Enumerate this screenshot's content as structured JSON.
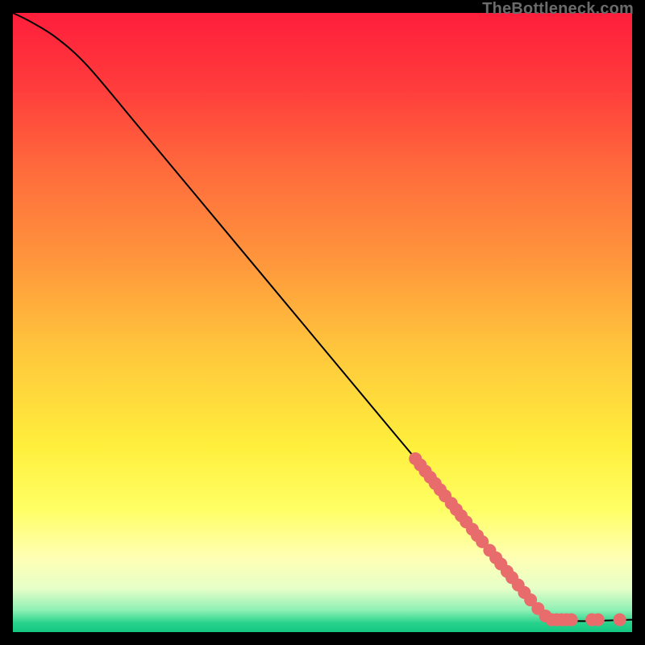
{
  "watermark": "TheBottleneck.com",
  "chart_data": {
    "type": "line",
    "title": "",
    "xlabel": "",
    "ylabel": "",
    "xlim": [
      0,
      100
    ],
    "ylim": [
      0,
      100
    ],
    "grid": false,
    "legend": false,
    "gradient_stops": [
      {
        "t": 0.0,
        "color": "#FF1E3C"
      },
      {
        "t": 0.12,
        "color": "#FF3C3C"
      },
      {
        "t": 0.25,
        "color": "#FF6A3C"
      },
      {
        "t": 0.4,
        "color": "#FF963C"
      },
      {
        "t": 0.55,
        "color": "#FFC83C"
      },
      {
        "t": 0.7,
        "color": "#FFEF3C"
      },
      {
        "t": 0.8,
        "color": "#FFFF64"
      },
      {
        "t": 0.88,
        "color": "#FFFFB4"
      },
      {
        "t": 0.93,
        "color": "#E6FFC8"
      },
      {
        "t": 0.965,
        "color": "#8CF0B4"
      },
      {
        "t": 0.985,
        "color": "#28D28C"
      },
      {
        "t": 1.0,
        "color": "#14C882"
      }
    ],
    "curve": [
      {
        "x": 0,
        "y": 100
      },
      {
        "x": 3,
        "y": 98.5
      },
      {
        "x": 7,
        "y": 96
      },
      {
        "x": 12,
        "y": 91.5
      },
      {
        "x": 20,
        "y": 82
      },
      {
        "x": 30,
        "y": 70
      },
      {
        "x": 40,
        "y": 58
      },
      {
        "x": 50,
        "y": 46
      },
      {
        "x": 60,
        "y": 34
      },
      {
        "x": 70,
        "y": 22
      },
      {
        "x": 78,
        "y": 12
      },
      {
        "x": 84,
        "y": 5
      },
      {
        "x": 88,
        "y": 2
      },
      {
        "x": 100,
        "y": 2
      }
    ],
    "scatter": [
      {
        "x": 65.0,
        "y": 28.0
      },
      {
        "x": 65.8,
        "y": 27.0
      },
      {
        "x": 66.6,
        "y": 26.0
      },
      {
        "x": 67.4,
        "y": 25.0
      },
      {
        "x": 68.2,
        "y": 24.0
      },
      {
        "x": 69.0,
        "y": 23.0
      },
      {
        "x": 69.8,
        "y": 22.0
      },
      {
        "x": 70.8,
        "y": 20.8
      },
      {
        "x": 71.6,
        "y": 19.8
      },
      {
        "x": 72.4,
        "y": 18.8
      },
      {
        "x": 73.2,
        "y": 17.8
      },
      {
        "x": 74.2,
        "y": 16.6
      },
      {
        "x": 75.0,
        "y": 15.6
      },
      {
        "x": 75.8,
        "y": 14.6
      },
      {
        "x": 77.0,
        "y": 13.2
      },
      {
        "x": 78.0,
        "y": 12.0
      },
      {
        "x": 78.8,
        "y": 11.0
      },
      {
        "x": 79.8,
        "y": 9.8
      },
      {
        "x": 80.6,
        "y": 8.8
      },
      {
        "x": 81.6,
        "y": 7.6
      },
      {
        "x": 82.6,
        "y": 6.4
      },
      {
        "x": 83.6,
        "y": 5.2
      },
      {
        "x": 84.8,
        "y": 3.8
      },
      {
        "x": 86.0,
        "y": 2.6
      },
      {
        "x": 87.0,
        "y": 2.0
      },
      {
        "x": 87.8,
        "y": 2.0
      },
      {
        "x": 88.6,
        "y": 2.0
      },
      {
        "x": 89.4,
        "y": 2.0
      },
      {
        "x": 90.2,
        "y": 2.0
      },
      {
        "x": 93.5,
        "y": 2.0
      },
      {
        "x": 94.5,
        "y": 2.0
      },
      {
        "x": 98.0,
        "y": 2.0
      }
    ],
    "scatter_color": "#E86C6C",
    "scatter_radius": 8
  }
}
